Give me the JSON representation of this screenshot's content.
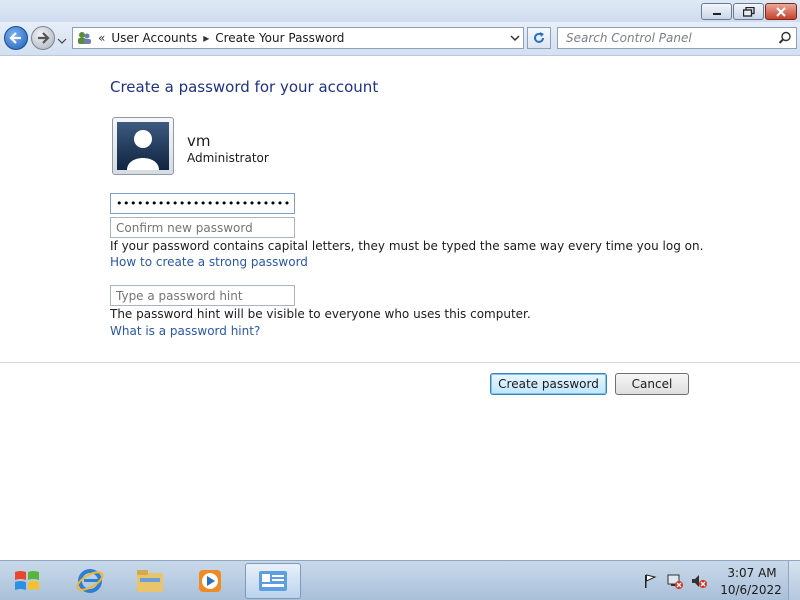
{
  "window": {
    "controls": [
      "minimize-icon",
      "restore-icon",
      "close-icon"
    ]
  },
  "nav": {
    "back_icon": "arrow-left-icon",
    "forward_icon": "arrow-right-icon",
    "breadcrumb_overflow": "«",
    "breadcrumbs": [
      "User Accounts",
      "Create Your Password"
    ],
    "breadcrumb_separator": "▸",
    "search_placeholder": "Search Control Panel"
  },
  "main": {
    "title": "Create a password for your account",
    "user": {
      "name": "vm",
      "role": "Administrator"
    },
    "new_password_value": "••••••••••••••••••••••••••",
    "confirm_placeholder": "Confirm new password",
    "caps_note": "If your password contains capital letters, they must be typed the same way every time you log on.",
    "strong_password_link": "How to create a strong password",
    "hint_placeholder": "Type a password hint",
    "hint_note": "The password hint will be visible to everyone who uses this computer.",
    "hint_link": "What is a password hint?",
    "create_button": "Create password",
    "cancel_button": "Cancel"
  },
  "taskbar": {
    "apps": [
      "windows-start-icon",
      "internet-explorer-icon",
      "file-explorer-icon",
      "media-player-icon",
      "control-panel-icon"
    ],
    "tray": [
      "action-center-flag-icon",
      "network-error-icon",
      "volume-muted-icon"
    ],
    "time": "3:07 AM",
    "date": "10/6/2022"
  },
  "colors": {
    "title_text": "#1e3287",
    "link_text": "#2a57a7",
    "accent_button_border": "#3c7fb1"
  }
}
